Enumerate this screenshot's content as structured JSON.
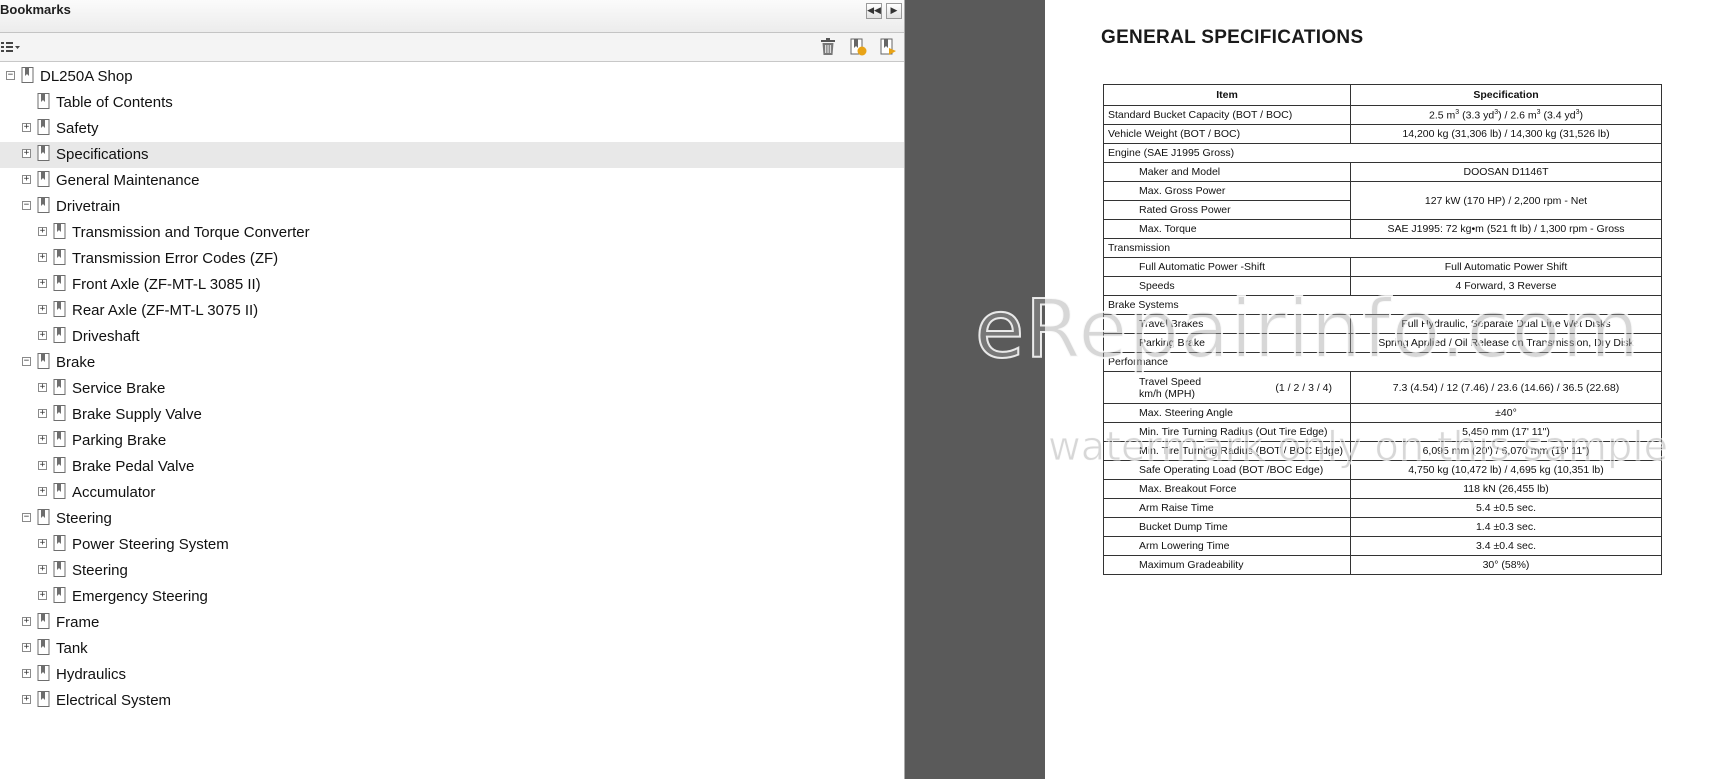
{
  "bookmarks": {
    "title": "Bookmarks",
    "tree": [
      {
        "label": "DL250A Shop",
        "level": 0,
        "expander": "minus"
      },
      {
        "label": "Table of Contents",
        "level": 1,
        "expander": "none"
      },
      {
        "label": "Safety",
        "level": 1,
        "expander": "plus"
      },
      {
        "label": "Specifications",
        "level": 1,
        "expander": "plus",
        "selected": true
      },
      {
        "label": "General Maintenance",
        "level": 1,
        "expander": "plus"
      },
      {
        "label": "Drivetrain",
        "level": 1,
        "expander": "minus"
      },
      {
        "label": "Transmission and Torque Converter",
        "level": 2,
        "expander": "plus"
      },
      {
        "label": "Transmission Error Codes (ZF)",
        "level": 2,
        "expander": "plus"
      },
      {
        "label": "Front Axle (ZF-MT-L 3085 II)",
        "level": 2,
        "expander": "plus"
      },
      {
        "label": "Rear Axle (ZF-MT-L 3075 II)",
        "level": 2,
        "expander": "plus"
      },
      {
        "label": "Driveshaft",
        "level": 2,
        "expander": "plus"
      },
      {
        "label": "Brake",
        "level": 1,
        "expander": "minus"
      },
      {
        "label": "Service Brake",
        "level": 2,
        "expander": "plus"
      },
      {
        "label": "Brake Supply Valve",
        "level": 2,
        "expander": "plus"
      },
      {
        "label": "Parking Brake",
        "level": 2,
        "expander": "plus"
      },
      {
        "label": "Brake Pedal Valve",
        "level": 2,
        "expander": "plus"
      },
      {
        "label": "Accumulator",
        "level": 2,
        "expander": "plus"
      },
      {
        "label": "Steering",
        "level": 1,
        "expander": "minus"
      },
      {
        "label": "Power Steering System",
        "level": 2,
        "expander": "plus"
      },
      {
        "label": "Steering",
        "level": 2,
        "expander": "plus"
      },
      {
        "label": "Emergency Steering",
        "level": 2,
        "expander": "plus"
      },
      {
        "label": "Frame",
        "level": 1,
        "expander": "plus"
      },
      {
        "label": "Tank",
        "level": 1,
        "expander": "plus"
      },
      {
        "label": "Hydraulics",
        "level": 1,
        "expander": "plus"
      },
      {
        "label": "Electrical System",
        "level": 1,
        "expander": "plus"
      }
    ]
  },
  "document": {
    "title": "GENERAL SPECIFICATIONS",
    "table": {
      "headers": {
        "item": "Item",
        "spec": "Specification"
      },
      "bucket": {
        "item": "Standard Bucket Capacity (BOT / BOC)",
        "v1": "2.5 m",
        "v2": " (3.3 yd",
        "v3": ") / 2.6 m",
        "v4": " (3.4 yd",
        "v5": ")",
        "exp": "3"
      },
      "weight": {
        "item": "Vehicle Weight (BOT / BOC)",
        "value": "14,200 kg (31,306 lb) / 14,300 kg (31,526 lb)"
      },
      "engine": {
        "heading": "Engine (SAE J1995 Gross)",
        "maker_item": "Maker and Model",
        "maker_value": "DOOSAN D1146T",
        "max_gross_item": "Max. Gross Power",
        "rated_gross_item": "Rated Gross Power",
        "power_value": "127 kW (170 HP) / 2,200 rpm - Net",
        "torque_item": "Max. Torque",
        "torque_value": "SAE J1995: 72 kg•m (521 ft lb) / 1,300 rpm - Gross"
      },
      "transmission": {
        "heading": "Transmission",
        "auto_item": "Full Automatic Power -Shift",
        "auto_value": "Full Automatic Power Shift",
        "speeds_item": "Speeds",
        "speeds_value": "4 Forward, 3 Reverse"
      },
      "brakes": {
        "heading": "Brake Systems",
        "travel_item": "Travel Brakes",
        "travel_value": "Full Hydraulic, Separate Dual Line Wet Disks",
        "parking_item": "Parking Brake",
        "parking_value": "Spring Applied / Oil Release on Transmission, Dry Disk"
      },
      "performance": {
        "heading": "Performance",
        "travel_item_line1": "Travel Speed",
        "travel_item_line2": "km/h (MPH)",
        "travel_item_gears": "(1 / 2 / 3 / 4)",
        "travel_value": "7.3 (4.54) / 12 (7.46) / 23.6 (14.66) / 36.5 (22.68)",
        "steering_item": "Max. Steering Angle",
        "steering_value": "±40°",
        "turn_out_item": "Min. Tire Turning Radius (Out Tire Edge)",
        "turn_out_value": "5,450 mm (17' 11\")",
        "turn_boc_item": "Min. Tire Turning Radius (BOT / BOC Edge)",
        "turn_boc_value": "6,095 mm (20') / 6,070 mm (19' 11\")",
        "load_item": "Safe Operating Load (BOT  /BOC Edge)",
        "load_value": "4,750 kg (10,472 lb) / 4,695 kg (10,351 lb)",
        "breakout_item": "Max. Breakout Force",
        "breakout_value": "118 kN (26,455 lb)",
        "raise_item": "Arm Raise Time",
        "raise_value": "5.4 ±0.5 sec.",
        "dump_item": "Bucket Dump Time",
        "dump_value": "1.4 ±0.3 sec.",
        "lower_item": "Arm Lowering Time",
        "lower_value": "3.4 ±0.4 sec.",
        "grade_item": "Maximum Gradeability",
        "grade_value": "30° (58%)"
      }
    }
  },
  "watermark": {
    "line1": "eRepairinfo.com",
    "line2": "watermark only on this sample"
  }
}
